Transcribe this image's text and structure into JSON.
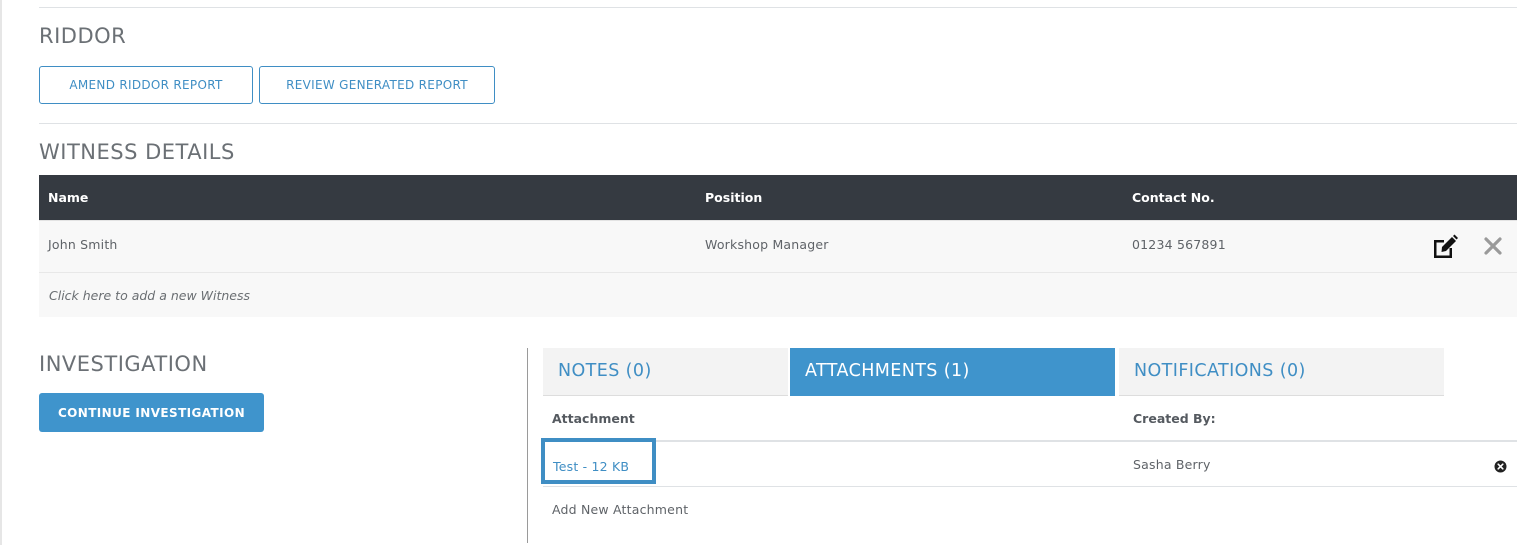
{
  "riddor": {
    "title": "RIDDOR",
    "amend_label": "AMEND RIDDOR REPORT",
    "review_label": "REVIEW GENERATED REPORT"
  },
  "witness": {
    "title": "WITNESS DETAILS",
    "columns": [
      "Name",
      "Position",
      "Contact No."
    ],
    "rows": [
      {
        "name": "John Smith",
        "position": "Workshop Manager",
        "contact": "01234 567891"
      }
    ],
    "add_text": "Click here to add a new Witness",
    "icons": {
      "edit": "edit-icon",
      "delete": "close-icon"
    }
  },
  "investigation": {
    "title": "INVESTIGATION",
    "continue_label": "CONTINUE INVESTIGATION"
  },
  "tabs": [
    {
      "label": "NOTES (0)",
      "active": false
    },
    {
      "label": "ATTACHMENTS (1)",
      "active": true
    },
    {
      "label": "NOTIFICATIONS (0)",
      "active": false
    }
  ],
  "attachments": {
    "columns": [
      "Attachment",
      "Created By:"
    ],
    "rows": [
      {
        "file": "Test - 12 KB",
        "created_by": "Sasha Berry"
      }
    ],
    "add_label": "Add New Attachment"
  },
  "colors": {
    "accent": "#3f94cc",
    "table_header": "#353a41"
  }
}
